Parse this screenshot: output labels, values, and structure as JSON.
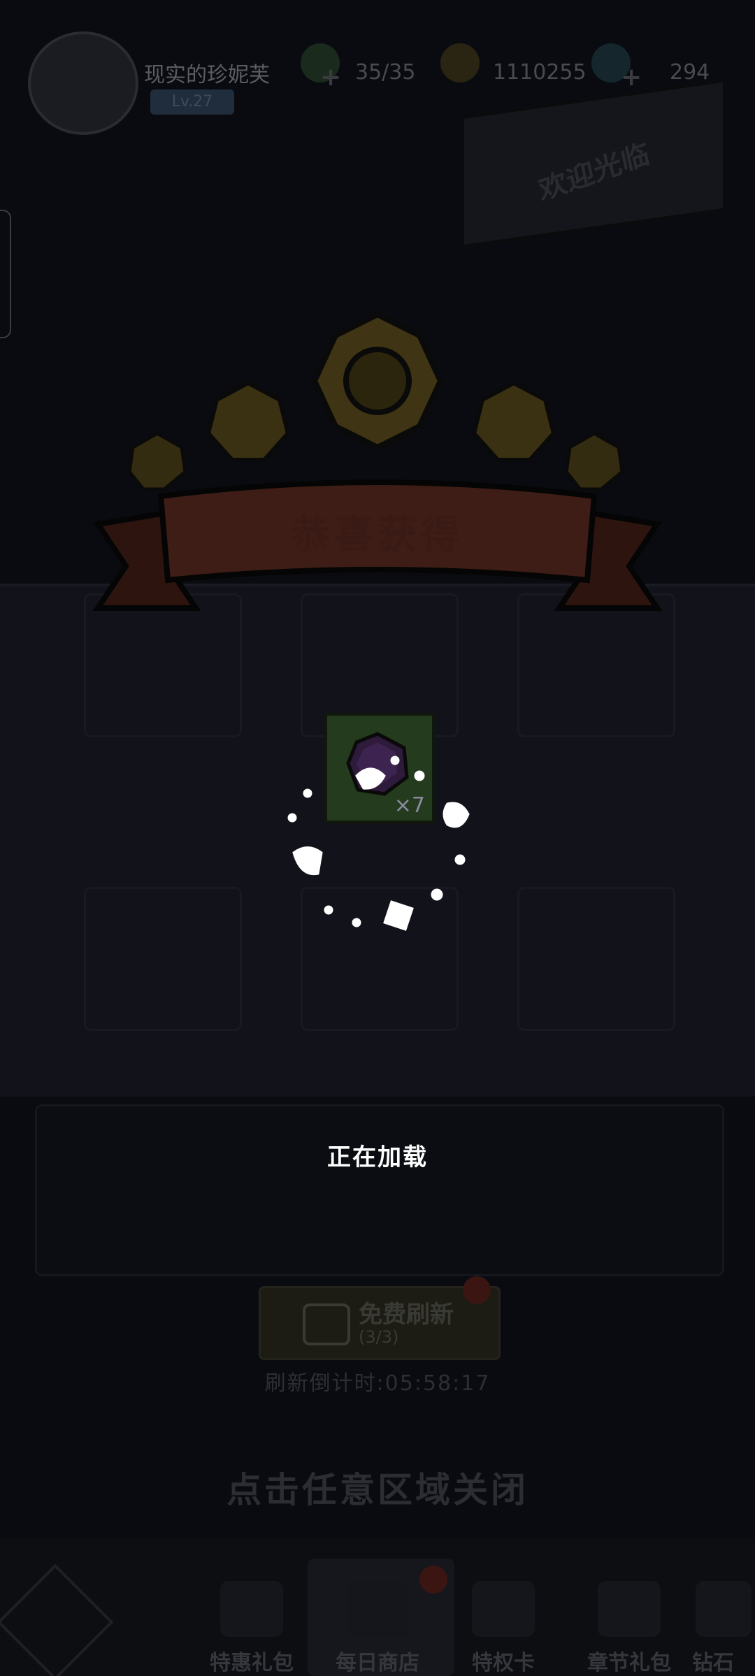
{
  "player": {
    "name": "现实的珍妮芙",
    "level": "Lv.27"
  },
  "resources": {
    "stamina": "35/35",
    "gold": "1110255",
    "diamonds": "294"
  },
  "shop": {
    "welcome_text": "欢迎光临",
    "refresh_button": "免费刷新",
    "refresh_count": "(3/3)",
    "refresh_timer": "刷新倒计时:05:58:17",
    "close_hint": "点击任意区域关闭"
  },
  "reward": {
    "title": "恭喜获得",
    "item_icon": "purple-gem-icon",
    "quantity": "×7"
  },
  "loading_text": "正在加载",
  "bottom_nav": [
    {
      "label": "特惠礼包",
      "icon": "lightning-gift-icon"
    },
    {
      "label": "每日商店",
      "icon": "gift-box-icon"
    },
    {
      "label": "特权卡",
      "icon": "card-icon"
    },
    {
      "label": "章节礼包",
      "icon": "chapter-gift-icon"
    },
    {
      "label": "钻石",
      "icon": "diamond-icon"
    }
  ],
  "colors": {
    "overlay": "#07080c",
    "ribbon": "#3d1d15",
    "flower": "#3f3514",
    "reward_bg": "#243b1e"
  }
}
